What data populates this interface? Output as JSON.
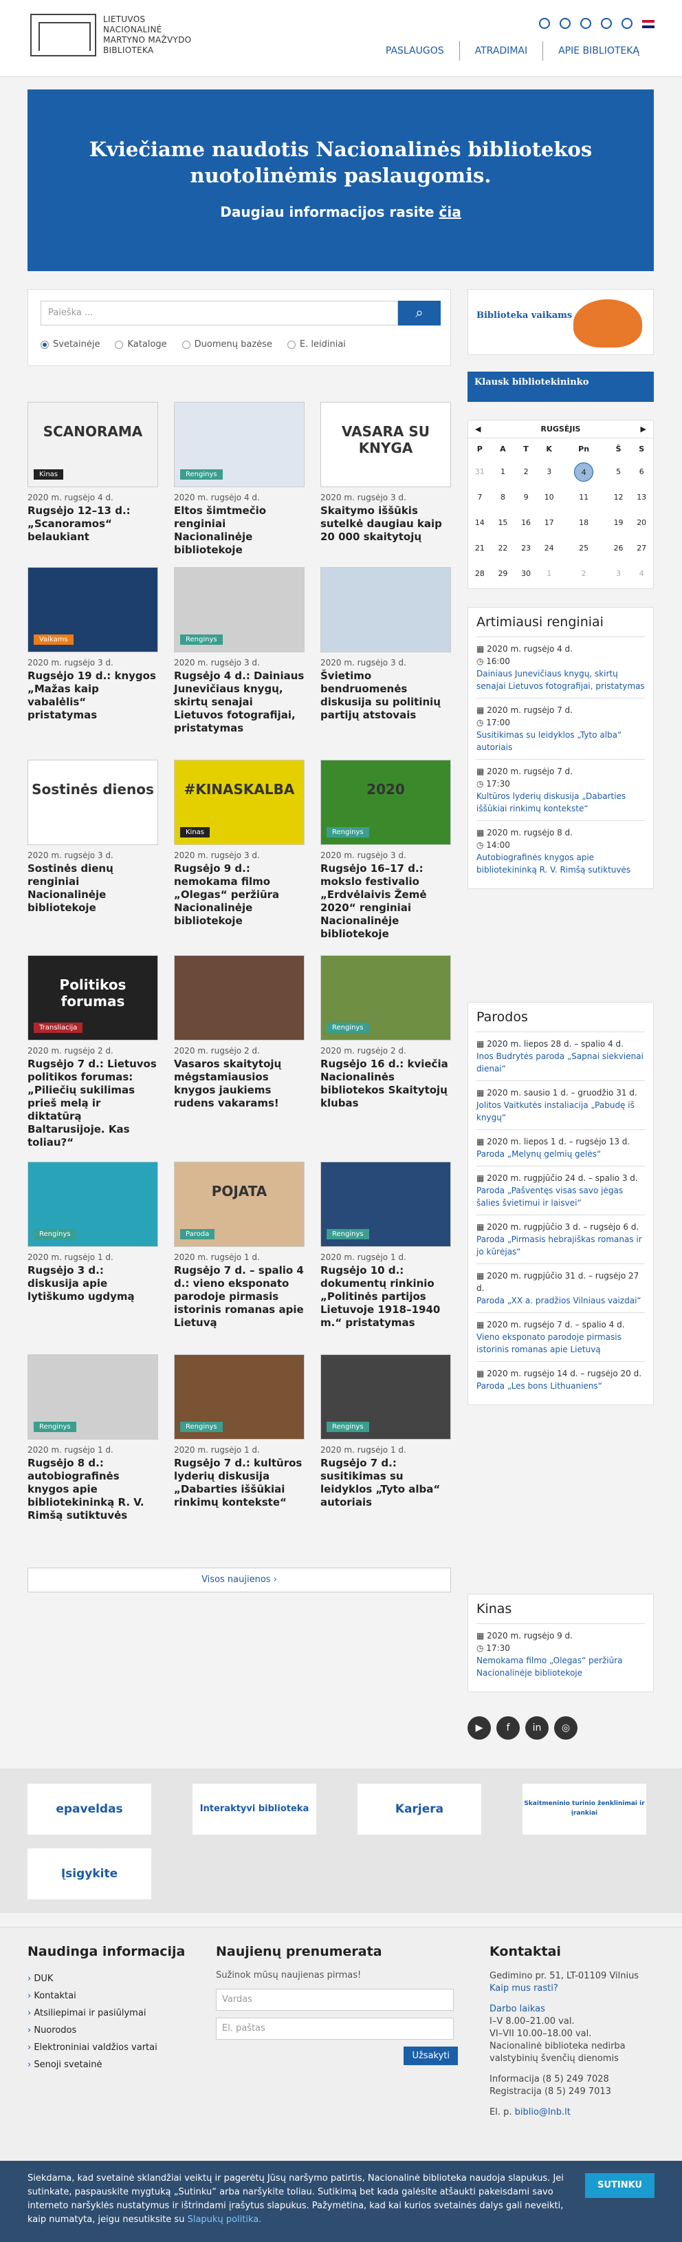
{
  "header": {
    "logo_text": [
      "Lietuvos",
      "Nacionalinė",
      "Martyno Mažvydo",
      "biblioteka"
    ],
    "nav": [
      "PASLAUGOS",
      "ATRADIMAI",
      "APIE BIBLIOTEKĄ"
    ]
  },
  "hero": {
    "title_1": "Kviečiame naudotis Nacionalinės bibliotekos",
    "title_2": "nuotolinėmis paslaugomis.",
    "sub": "Daugiau informacijos rasite",
    "sub_link": "čia"
  },
  "search": {
    "placeholder": "Paieška ...",
    "options": [
      "Svetainėje",
      "Kataloge",
      "Duomenų bazėse",
      "E. leidiniai"
    ]
  },
  "news": [
    {
      "date": "2020 m. rugsėjo 4 d.",
      "title": "Rugsėjo 12–13 d.: „Scanoramos“ belaukiant",
      "tag": "Kinas",
      "thumb": "SCANORAMA"
    },
    {
      "date": "2020 m. rugsėjo 4 d.",
      "title": "Eltos šimtmečio renginiai Nacionalinėje bibliotekoje",
      "tag": "Renginys",
      "thumb": ""
    },
    {
      "date": "2020 m. rugsėjo 3 d.",
      "title": "Skaitymo iššūkis sutelkė daugiau kaip 20 000 skaitytojų",
      "tag": "",
      "thumb": "VASARA SU KNYGA"
    },
    {
      "date": "2020 m. rugsėjo 3 d.",
      "title": "Rugsėjo 19 d.: knygos „Mažas kaip vabalėlis“ pristatymas",
      "tag": "Vaikams",
      "thumb": ""
    },
    {
      "date": "2020 m. rugsėjo 3 d.",
      "title": "Rugsėjo 4 d.: Dainiaus Junevičiaus knygų, skirtų senajai Lietuvos fotografijai, pristatymas",
      "tag": "Renginys",
      "thumb": ""
    },
    {
      "date": "2020 m. rugsėjo 3 d.",
      "title": "Švietimo bendruomenės diskusija su politinių partijų atstovais",
      "tag": "",
      "thumb": ""
    },
    {
      "date": "2020 m. rugsėjo 3 d.",
      "title": "Sostinės dienų renginiai Nacionalinėje bibliotekoje",
      "tag": "",
      "thumb": "Sostinės dienos"
    },
    {
      "date": "2020 m. rugsėjo 3 d.",
      "title": "Rugsėjo 9 d.: nemokama filmo „Olegas“ peržiūra Nacionalinėje bibliotekoje",
      "tag": "Kinas",
      "thumb": "#KINASKALBA"
    },
    {
      "date": "2020 m. rugsėjo 3 d.",
      "title": "Rugsėjo 16–17 d.: mokslo festivalio „Erdvėlaivis Žemė 2020“ renginiai Nacionalinėje bibliotekoje",
      "tag": "Renginys",
      "thumb": "2020"
    },
    {
      "date": "2020 m. rugsėjo 2 d.",
      "title": "Rugsėjo 7 d.: Lietuvos politikos forumas: „Piliečių sukilimas prieš melą ir diktatūrą Baltarusijoje. Kas toliau?“",
      "tag": "Transliacija",
      "thumb": "Politikos forumas"
    },
    {
      "date": "2020 m. rugsėjo 2 d.",
      "title": "Vasaros skaitytojų mėgstamiausios knygos jaukiems rudens vakarams!",
      "tag": "",
      "thumb": ""
    },
    {
      "date": "2020 m. rugsėjo 2 d.",
      "title": "Rugsėjo 16 d.: kviečia Nacionalinės bibliotekos Skaitytojų klubas",
      "tag": "Renginys",
      "thumb": ""
    },
    {
      "date": "2020 m. rugsėjo 1 d.",
      "title": "Rugsėjo 3 d.: diskusija apie lytiškumo ugdymą",
      "tag": "Renginys",
      "thumb": ""
    },
    {
      "date": "2020 m. rugsėjo 1 d.",
      "title": "Rugsėjo 7 d. – spalio 4 d.: vieno eksponato parodoje pirmasis istorinis romanas apie Lietuvą",
      "tag": "Paroda",
      "thumb": "POJATA"
    },
    {
      "date": "2020 m. rugsėjo 1 d.",
      "title": "Rugsėjo 10 d.: dokumentų rinkinio „Politinės partijos Lietuvoje 1918–1940 m.“ pristatymas",
      "tag": "Renginys",
      "thumb": ""
    },
    {
      "date": "2020 m. rugsėjo 1 d.",
      "title": "Rugsėjo 8 d.: autobiografinės knygos apie bibliotekininką R. V. Rimšą sutiktuvės",
      "tag": "Renginys",
      "thumb": ""
    },
    {
      "date": "2020 m. rugsėjo 1 d.",
      "title": "Rugsėjo 7 d.: kultūros lyderių diskusija „Dabarties iššūkiai rinkimų kontekste“",
      "tag": "Renginys",
      "thumb": ""
    },
    {
      "date": "2020 m. rugsėjo 1 d.",
      "title": "Rugsėjo 7 d.: susitikimas su leidyklos „Tyto alba“ autoriais",
      "tag": "Renginys",
      "thumb": ""
    }
  ],
  "more": "Visos naujienos ›",
  "kids": "Biblioteka vaikams",
  "ask": "Klausk bibliotekininko",
  "calendar": {
    "month": "RUGSĖJIS",
    "days": [
      "P",
      "A",
      "T",
      "K",
      "Pn",
      "Š",
      "S"
    ],
    "weeks": [
      [
        "31",
        "1",
        "2",
        "3",
        "4",
        "5",
        "6"
      ],
      [
        "7",
        "8",
        "9",
        "10",
        "11",
        "12",
        "13"
      ],
      [
        "14",
        "15",
        "16",
        "17",
        "18",
        "19",
        "20"
      ],
      [
        "21",
        "22",
        "23",
        "24",
        "25",
        "26",
        "27"
      ],
      [
        "28",
        "29",
        "30",
        "1",
        "2",
        "3",
        "4"
      ]
    ]
  },
  "events": {
    "title": "Artimiausi renginiai",
    "items": [
      {
        "date": "2020 m. rugsėjo 4 d.",
        "time": "16:00",
        "link": "Dainiaus Junevičiaus knygų, skirtų senajai Lietuvos fotografijai, pristatymas"
      },
      {
        "date": "2020 m. rugsėjo 7 d.",
        "time": "17:00",
        "link": "Susitikimas su leidyklos „Tyto alba“ autoriais"
      },
      {
        "date": "2020 m. rugsėjo 7 d.",
        "time": "17:30",
        "link": "Kultūros lyderių diskusija „Dabarties iššūkiai rinkimų kontekste“"
      },
      {
        "date": "2020 m. rugsėjo 8 d.",
        "time": "14:00",
        "link": "Autobiografinės knygos apie bibliotekininką R. V. Rimšą sutiktuvės"
      }
    ]
  },
  "exhibitions": {
    "title": "Parodos",
    "items": [
      {
        "date": "2020 m. liepos 28 d. – spalio 4 d.",
        "link": "Inos Budrytės paroda „Sapnai siekvienai dienai“"
      },
      {
        "date": "2020 m. sausio 1 d. – gruodžio 31 d.",
        "link": "Jolitos Vaitkutės instaliacija „Pabudę iš knygų“"
      },
      {
        "date": "2020 m. liepos 1 d. – rugsėjo 13 d.",
        "link": "Paroda „Melynų gelmių gelės“"
      },
      {
        "date": "2020 m. rugpjūčio 24 d. – spalio 3 d.",
        "link": "Paroda „Pašventęs visas savo jėgas šalies švietimui ir laisvei“"
      },
      {
        "date": "2020 m. rugpjūčio 3 d. – rugsėjo 6 d.",
        "link": "Paroda „Pirmasis hebrajiškas romanas ir jo kūrėjas“"
      },
      {
        "date": "2020 m. rugpjūčio 31 d. – rugsėjo 27 d.",
        "link": "Paroda „XX a. pradžios Vilniaus vaizdai“"
      },
      {
        "date": "2020 m. rugsėjo 7 d. – spalio 4 d.",
        "link": "Vieno eksponato parodoje pirmasis istorinis romanas apie Lietuvą"
      },
      {
        "date": "2020 m. rugsėjo 14 d. – rugsėjo 20 d.",
        "link": "Paroda „Les bons Lithuaniens“"
      }
    ]
  },
  "cinema": {
    "title": "Kinas",
    "date": "2020 m. rugsėjo 9 d.",
    "time": "17:30",
    "link": "Nemokama filmo „Olegas“ peržiūra Nacionalinėje bibliotekoje"
  },
  "partners": [
    "epaveldas",
    "Interaktyvi biblioteka",
    "Karjera",
    "Skaitmeninio turinio ženklinimai ir įrankiai",
    "Įsigykite"
  ],
  "footer": {
    "info_title": "Naudinga informacija",
    "info_items": [
      "DUK",
      "Kontaktai",
      "Atsiliepimai ir pasiūlymai",
      "Nuorodos",
      "Elektroniniai valdžios vartai",
      "Senoji svetainė"
    ],
    "news_title": "Naujienų prenumerata",
    "news_sub": "Sužinok mūsų naujienas pirmas!",
    "name_ph": "Vardas",
    "email_ph": "El. paštas",
    "subscribe": "Užsakyti",
    "contact_title": "Kontaktai",
    "address": "Gedimino pr. 51, LT-01109 Vilnius",
    "route": "Kaip mus rasti?",
    "hours_title": "Darbo laikas",
    "hours": [
      "I–V 8.00–21.00 val.",
      "VI–VII 10.00–18.00 val.",
      "Nacionalinė biblioteka nedirba valstybinių švenčių dienomis"
    ],
    "phone_info": "Informacija (8 5) 249 7028",
    "phone_reg": "Registracija (8 5) 249 7013",
    "email_label": "El. p.",
    "email": "biblio@lnb.lt"
  },
  "cookie": {
    "text": "Siekdama, kad svetainė sklandžiai veiktų ir pagerėtų Jūsų naršymo patirtis, Nacionalinė biblioteka naudoja slapukus. Jei sutinkate, paspauskite mygtuką „Sutinku“ arba naršykite toliau. Sutikimą bet kada galėsite atšaukti pakeisdami savo interneto naršyklės nustatymus ir ištrindami įrašytus slapukus. Pažymėtina, kad kai kurios svetainės dalys gali neveikti, kaip numatyta, jeigu nesutiksite su",
    "link": "Slapukų politika.",
    "btn": "SUTINKU"
  }
}
